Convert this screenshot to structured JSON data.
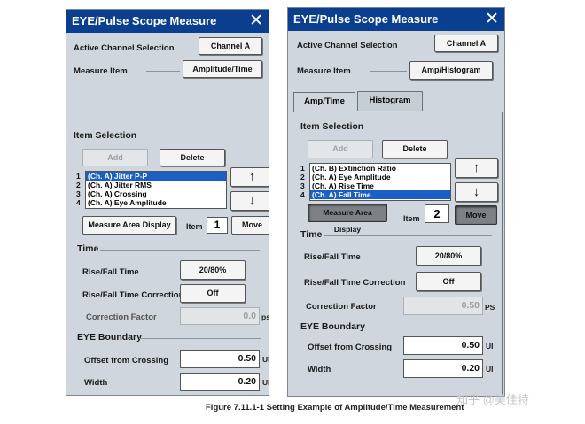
{
  "left": {
    "title": "EYE/Pulse Scope Measure",
    "close": "✕",
    "active_channel_label": "Active Channel Selection",
    "active_channel_value": "Channel A",
    "measure_item_label": "Measure Item",
    "measure_item_value": "Amplitude/Time",
    "item_selection": "Item Selection",
    "add": "Add",
    "delete": "Delete",
    "up": "↑",
    "down": "↓",
    "list": [
      {
        "num": "1",
        "text": "(Ch. A) Jitter P-P"
      },
      {
        "num": "2",
        "text": "(Ch. A) Jitter RMS"
      },
      {
        "num": "3",
        "text": "(Ch. A) Crossing"
      },
      {
        "num": "4",
        "text": "(Ch. A) Eye Amplitude"
      }
    ],
    "measure_area": "Measure Area Display",
    "item_label": "Item",
    "item_value": "1",
    "move": "Move",
    "time": "Time",
    "rise_fall_label": "Rise/Fall Time",
    "rise_fall_value": "20/80%",
    "rise_fall_corr_label": "Rise/Fall Time Correction",
    "rise_fall_corr_value": "Off",
    "corr_factor_label": "Correction Factor",
    "corr_factor_value": "0.0",
    "corr_factor_unit": "ps",
    "eye_boundary": "EYE Boundary",
    "offset_label": "Offset from Crossing",
    "offset_value": "0.50",
    "offset_unit": "UI",
    "width_label": "Width",
    "width_value": "0.20",
    "width_unit": "UI"
  },
  "right": {
    "title": "EYE/Pulse Scope Measure",
    "close": "✕",
    "active_channel_label": "Active Channel Selection",
    "active_channel_value": "Channel A",
    "measure_item_label": "Measure Item",
    "measure_item_value": "Amp/Histogram",
    "tab_amp_time": "Amp/Time",
    "tab_histogram": "Histogram",
    "item_selection": "Item Selection",
    "add": "Add",
    "delete": "Delete",
    "up": "↑",
    "down": "↓",
    "list": [
      {
        "num": "1",
        "text": "(Ch. B) Extinction Ratio"
      },
      {
        "num": "2",
        "text": "(Ch. A) Eye Amplitude"
      },
      {
        "num": "3",
        "text": "(Ch. A) Rise Time"
      },
      {
        "num": "4",
        "text": "(Ch. A) Fall Time"
      }
    ],
    "measure_area": "Measure Area Display",
    "item_label": "Item",
    "item_value": "2",
    "move": "Move",
    "time": "Time",
    "rise_fall_label": "Rise/Fall Time",
    "rise_fall_value": "20/80%",
    "rise_fall_corr_label": "Rise/Fall Time Correction",
    "rise_fall_corr_value": "Off",
    "corr_factor_label": "Correction Factor",
    "corr_factor_value": "0.50",
    "corr_factor_unit": "PS",
    "eye_boundary": "EYE Boundary",
    "offset_label": "Offset from Crossing",
    "offset_value": "0.50",
    "offset_unit": "UI",
    "width_label": "Width",
    "width_value": "0.20",
    "width_unit": "UI"
  },
  "caption": "Figure 7.11.1-1    Setting Example of Amplitude/Time Measurement",
  "watermark": "知乎 @美佳特"
}
